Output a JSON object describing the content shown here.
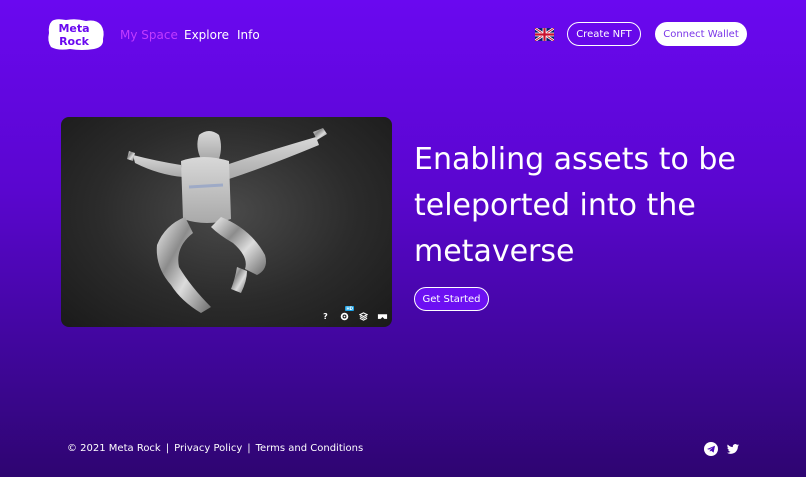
{
  "nav": {
    "logo_line1": "Meta",
    "logo_line2": "Rock",
    "links": [
      {
        "label": "My Space"
      },
      {
        "label": "Explore"
      },
      {
        "label": "Info"
      }
    ],
    "language_icon": "uk-flag-icon",
    "create_nft_label": "Create NFT",
    "connect_wallet_label": "Connect Wallet"
  },
  "viewer": {
    "tools": [
      {
        "icon": "help-icon",
        "glyph": "?"
      },
      {
        "icon": "settings-icon",
        "badge": "HD"
      },
      {
        "icon": "layers-icon"
      },
      {
        "icon": "vr-icon"
      }
    ]
  },
  "hero": {
    "line1": "Enabling assets to be",
    "line2": "teleported into the",
    "line3": "metaverse",
    "cta_label": "Get Started"
  },
  "footer": {
    "copyright": "© 2021 Meta Rock",
    "privacy": "Privacy Policy",
    "terms": "Terms and Conditions",
    "separator": "|",
    "social": [
      "telegram-icon",
      "twitter-icon"
    ]
  },
  "colors": {
    "accent": "#c23bff",
    "background_top": "#6a08f0",
    "background_bottom": "#2e0571",
    "wallet_text": "#7a36e8"
  }
}
